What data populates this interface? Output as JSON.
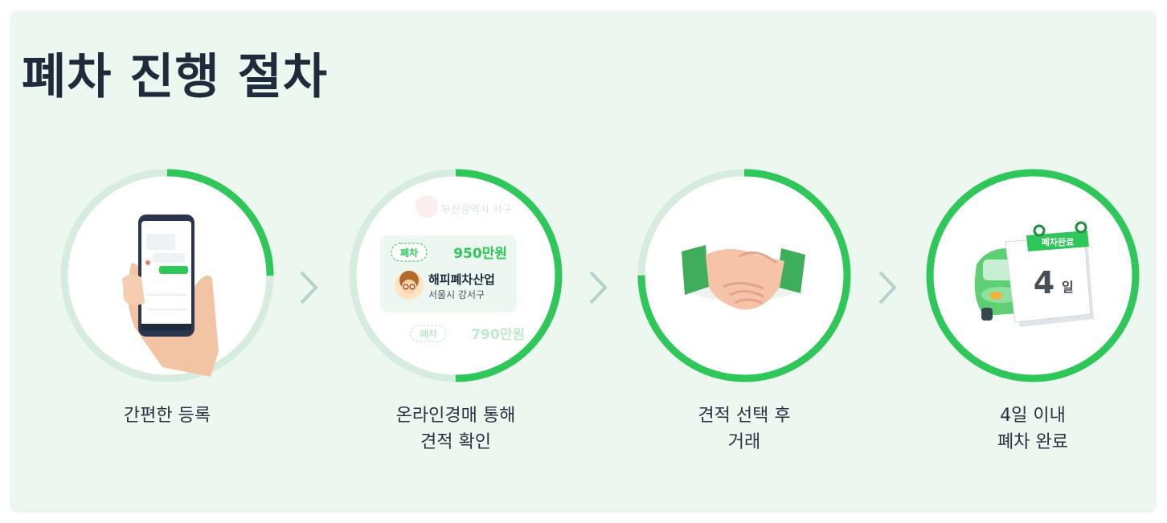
{
  "page": {
    "title": "폐차 진행 절차"
  },
  "colors": {
    "accent": "#2fc75a",
    "ring_track": "#d6ecdf",
    "panel_bg": "#ecf7f0",
    "title": "#1f2a3b"
  },
  "steps": [
    {
      "icon": "phone-in-hand-icon",
      "progress": 0.25,
      "caption_lines": [
        "간편한 등록"
      ]
    },
    {
      "icon": "bid-list-icon",
      "progress": 0.5,
      "caption_lines": [
        "온라인경매 통해",
        "견적 확인"
      ]
    },
    {
      "icon": "handshake-icon",
      "progress": 0.75,
      "caption_lines": [
        "견적 선택 후",
        "거래"
      ]
    },
    {
      "icon": "car-calendar-icon",
      "progress": 1.0,
      "caption_lines": [
        "4일 이내",
        "폐차 완료"
      ]
    }
  ],
  "bid_card": {
    "faded_location": "부산광역시 서구",
    "top_badge": "폐차",
    "top_price": "950만원",
    "company": "해피폐차산업",
    "location": "서울시 강서구",
    "bottom_badge": "폐차",
    "bottom_price": "790만원"
  },
  "calendar": {
    "badge": "폐차완료",
    "day_number": "4",
    "day_suffix": "일"
  },
  "separator_icon": "chevron-right-icon"
}
